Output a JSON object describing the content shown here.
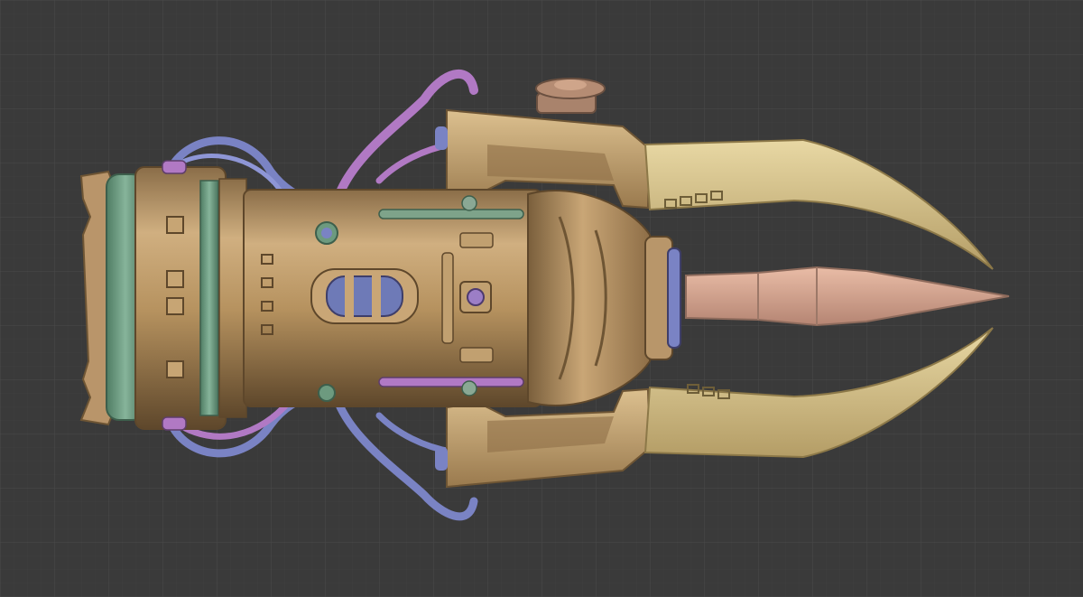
{
  "viewport": {
    "background": "#3a3a3a",
    "grid_color": "#474747",
    "grid_minor_color": "#3f3f3f"
  },
  "model": {
    "subject": "steampunk-claw-device",
    "palette": {
      "bronze_light": "#d2b283",
      "bronze_mid": "#b08d5e",
      "bronze_dark": "#6e5534",
      "blade": "#dfcd96",
      "blade_shade": "#b8a26b",
      "spike": "#dba792",
      "green_ring": "#6d9a7f",
      "cable_purple": "#b179c4",
      "cable_blue": "#7a83c4",
      "copper": "#a9836c"
    }
  }
}
